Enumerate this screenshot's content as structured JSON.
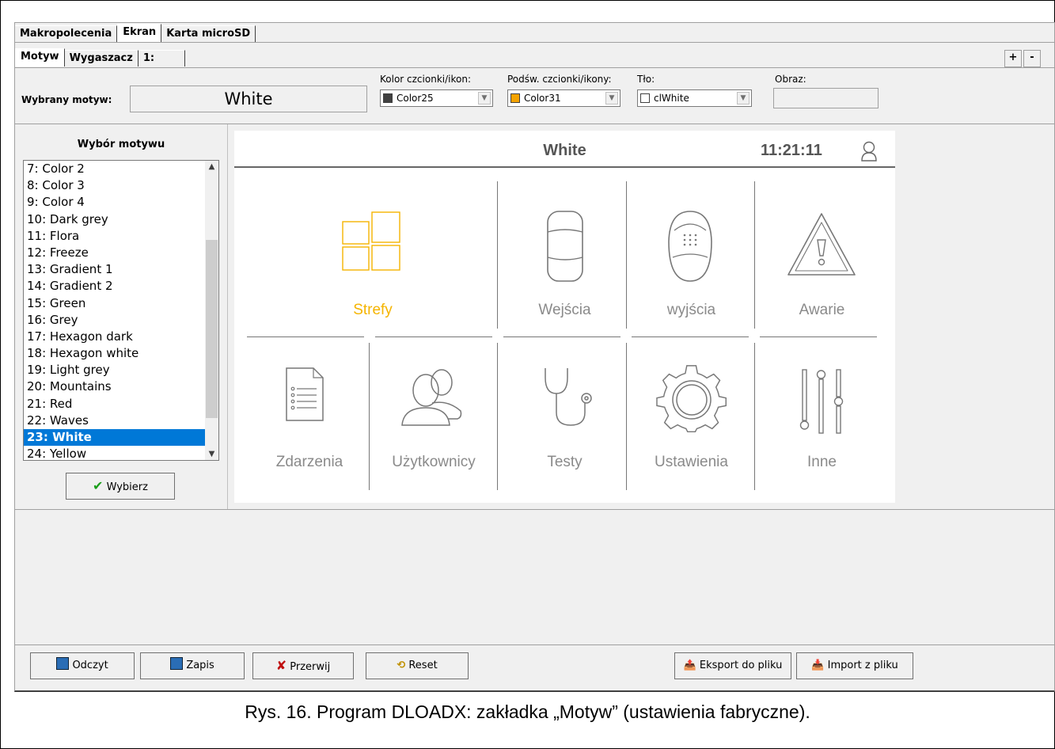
{
  "main_tabs": [
    "Makropolecenia",
    "Ekran",
    "Karta microSD"
  ],
  "sub_tabs": [
    "Motyw",
    "Wygaszacz",
    "1:"
  ],
  "plus_label": "+",
  "minus_label": "-",
  "selected_theme": {
    "label": "Wybrany motyw:",
    "value": "White"
  },
  "font_color": {
    "label": "Kolor czcionki/ikon:",
    "value": "Color25",
    "swatch": "#404040"
  },
  "highlight_color": {
    "label": "Podśw. czcionki/ikony:",
    "value": "Color31",
    "swatch": "#f5a300"
  },
  "background": {
    "label": "Tło:",
    "value": "clWhite",
    "swatch": "#ffffff"
  },
  "image": {
    "label": "Obraz:",
    "value": ""
  },
  "theme_list": {
    "title": "Wybór motywu",
    "items": [
      "7: Color 2",
      "8: Color 3",
      "9: Color 4",
      "10: Dark grey",
      "11: Flora",
      "12: Freeze",
      "13: Gradient 1",
      "14: Gradient 2",
      "15: Green",
      "16: Grey",
      "17: Hexagon dark",
      "18: Hexagon white",
      "19: Light grey",
      "20: Mountains",
      "21: Red",
      "22: Waves",
      "23: White",
      "24: Yellow"
    ],
    "selected_index": 16,
    "select_button": "Wybierz"
  },
  "preview": {
    "title": "White",
    "time": "11:21:11",
    "accent": "#f5b400",
    "row1": [
      "Strefy",
      "Wejścia",
      "wyjścia",
      "Awarie"
    ],
    "row2": [
      "Zdarzenia",
      "Użytkownicy",
      "Testy",
      "Ustawienia",
      "Inne"
    ]
  },
  "bottom_buttons": {
    "read": "Odczyt",
    "write": "Zapis",
    "abort": "Przerwij",
    "reset": "Reset",
    "export": "Eksport do pliku",
    "import": "Import z pliku"
  },
  "caption": "Rys. 16. Program DLOADX: zakładka „Motyw” (ustawienia fabryczne)."
}
